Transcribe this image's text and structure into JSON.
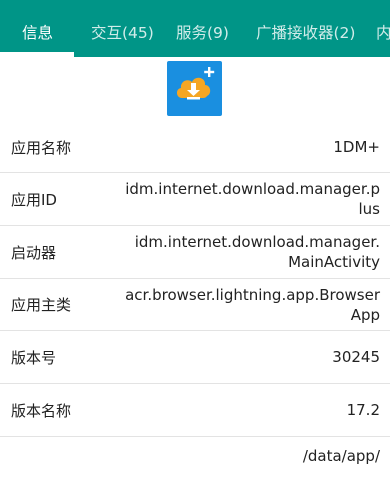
{
  "tabs": [
    {
      "label": "信息",
      "active": true
    },
    {
      "label": "交互(45)",
      "active": false
    },
    {
      "label": "服务(9)",
      "active": false
    },
    {
      "label": "广播接收器(2)",
      "active": false
    },
    {
      "label": "内",
      "active": false
    }
  ],
  "colors": {
    "tabbar": "#009587",
    "icon_background": "#1a8fe0",
    "cloud": "#f5a623"
  },
  "app_icon": "cloud-download-plus-icon",
  "rows": [
    {
      "label": "应用名称",
      "value": "1DM+"
    },
    {
      "label": "应用ID",
      "value": "idm.internet.download.manager.plus"
    },
    {
      "label": "启动器",
      "value": "idm.internet.download.manager.MainActivity"
    },
    {
      "label": "应用主类",
      "value": "acr.browser.lightning.app.BrowserApp"
    },
    {
      "label": "版本号",
      "value": "30245"
    },
    {
      "label": "版本名称",
      "value": "17.2"
    },
    {
      "label": "",
      "value": "/data/app/"
    }
  ]
}
